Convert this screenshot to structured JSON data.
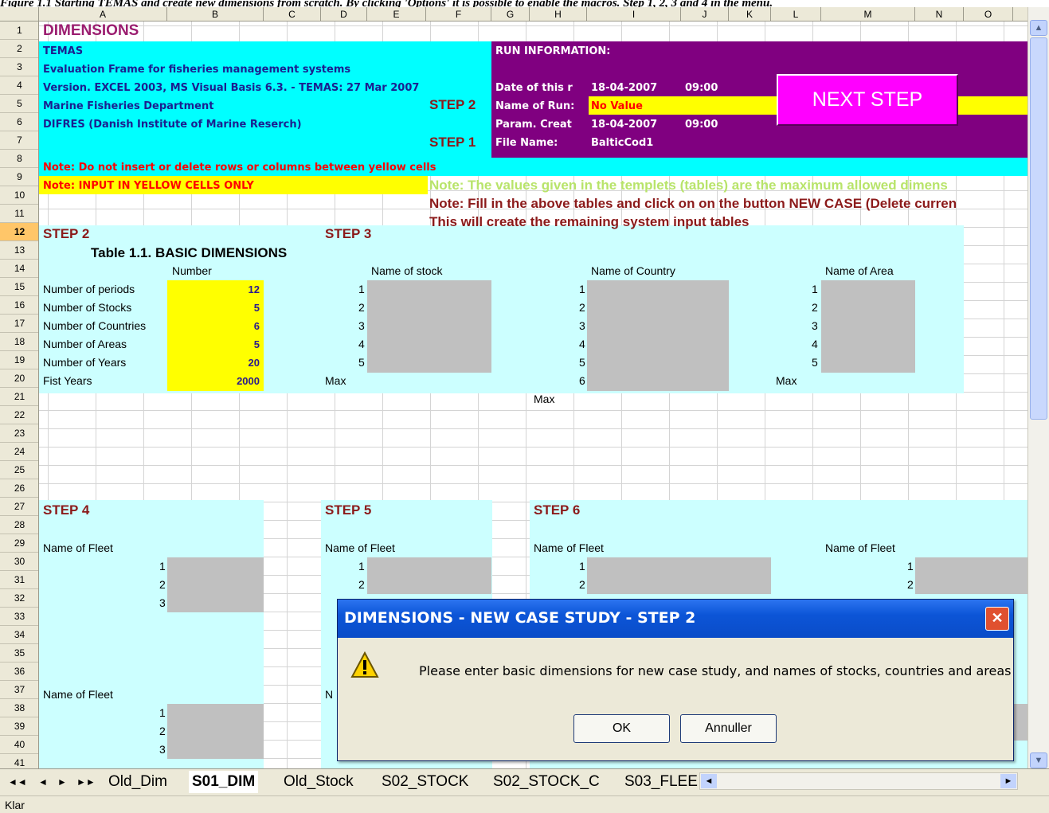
{
  "caption": "Figure 1.1 Starting TEMAS and create new dimensions from scratch. By clicking 'Options' it is possible to enable the macros. Step 1, 2, 3 and 4 in the menu.",
  "columns": [
    "A",
    "B",
    "C",
    "D",
    "E",
    "F",
    "G",
    "H",
    "I",
    "J",
    "K",
    "L",
    "M",
    "N",
    "O"
  ],
  "rows": [
    "1",
    "2",
    "3",
    "4",
    "5",
    "6",
    "7",
    "8",
    "9",
    "10",
    "11",
    "12",
    "13",
    "14",
    "15",
    "16",
    "17",
    "18",
    "19",
    "20",
    "21",
    "22",
    "23",
    "24",
    "25",
    "26",
    "27",
    "28",
    "29",
    "30",
    "31",
    "32",
    "33",
    "34",
    "35",
    "36",
    "37",
    "38",
    "39",
    "40",
    "41"
  ],
  "header_block": {
    "title": "DIMENSIONS",
    "line1": "TEMAS",
    "line2": "Evaluation Frame for fisheries management systems",
    "line3": "Version. EXCEL 2003, MS Visual Basis 6.3. - TEMAS: 27 Mar 2007",
    "line4": "Marine Fisheries Department",
    "line5": "DIFRES (Danish Institute of Marine Reserch)",
    "step2_marker": "STEP 2",
    "step1_marker": "STEP 1"
  },
  "run_info": {
    "title": "RUN INFORMATION:",
    "date_label": "Date of this r",
    "date_value": "18-04-2007",
    "date_time": "09:00",
    "name_label": "Name of Run:",
    "name_value": "No Value",
    "param_label": "Param. Creat",
    "param_value": "18-04-2007",
    "param_time": "09:00",
    "file_label": "File Name:",
    "file_value": "BalticCod1",
    "next_step_button": "NEXT STEP"
  },
  "notes": {
    "note1": "Note: Do not insert or delete rows or columns between yellow cells",
    "note2": "Note: INPUT IN YELLOW CELLS ONLY",
    "note3": "Note: The values given in the templets (tables) are the maximum allowed dimens",
    "note4": "Note: Fill in the above tables and click on on the button NEW CASE (Delete curren",
    "note5": "This will create the remaining system input tables"
  },
  "step2": {
    "heading": "STEP 2",
    "table_title": "Table 1.1.  BASIC DIMENSIONS",
    "col_header": "Number",
    "rows": [
      {
        "label": "Number of periods",
        "value": "12"
      },
      {
        "label": "Number of Stocks",
        "value": "5"
      },
      {
        "label": "Number of Countries",
        "value": "6"
      },
      {
        "label": "Number of Areas",
        "value": "5"
      },
      {
        "label": "Number of Years",
        "value": "20"
      },
      {
        "label": "Fist Years",
        "value": "2000"
      }
    ]
  },
  "step3": {
    "heading": "STEP 3",
    "stock_header": "Name of stock",
    "country_header": "Name of Country",
    "area_header": "Name of Area",
    "stock_indices": [
      "1",
      "2",
      "3",
      "4",
      "5"
    ],
    "country_indices": [
      "1",
      "2",
      "3",
      "4",
      "5",
      "6"
    ],
    "area_indices": [
      "1",
      "2",
      "3",
      "4",
      "5"
    ],
    "max_label": "Max"
  },
  "step4": {
    "heading": "STEP 4",
    "fleet_header": "Name of Fleet",
    "indices": [
      "1",
      "2",
      "3"
    ]
  },
  "step5": {
    "heading": "STEP 5",
    "fleet_header": "Name of Fleet",
    "indices": [
      "1",
      "2"
    ],
    "partial_label": "N"
  },
  "step6": {
    "heading": "STEP 6",
    "fleet_header": "Name of Fleet",
    "indices": [
      "1",
      "2"
    ]
  },
  "step6b": {
    "fleet_header": "Name of Fleet",
    "indices": [
      "1",
      "2"
    ]
  },
  "dialog": {
    "title": "DIMENSIONS - NEW CASE STUDY - STEP 2",
    "message": "Please enter basic dimensions for new case study, and names of stocks, countries and areas",
    "ok_label": "OK",
    "cancel_label": "Annuller",
    "icon": "warning-icon"
  },
  "sheet_tabs": [
    "Old_Dim",
    "S01_DIM",
    "Old_Stock",
    "S02_STOCK",
    "S02_STOCK_C",
    "S03_FLEE"
  ],
  "active_tab": "S01_DIM",
  "status": "Klar",
  "colors": {
    "cyan": "#00ffff",
    "light_cyan": "#ccffff",
    "purple": "#800080",
    "magenta": "#ff00ff",
    "yellow": "#ffff00",
    "step_red": "#8b1a1a",
    "gray": "#c0c0c0"
  }
}
